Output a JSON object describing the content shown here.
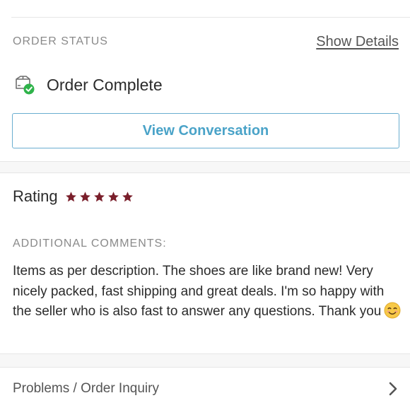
{
  "order_status": {
    "section_label": "ORDER STATUS",
    "show_details_label": "Show Details",
    "status_icon": "package-check-icon",
    "status_text": "Order Complete",
    "view_conversation_label": "View Conversation"
  },
  "rating": {
    "label": "Rating",
    "stars": 5,
    "max_stars": 5,
    "star_color": "#7a1f2b"
  },
  "comments": {
    "label": "ADDITIONAL COMMENTS:",
    "text": "Items as per description. The shoes are like brand new! Very nicely packed, fast shipping and great deals. I'm so happy with the seller who is also fast to answer any questions. Thank you",
    "emoji": "smiling-face-icon"
  },
  "inquiry": {
    "label": "Problems / Order Inquiry",
    "icon": "chevron-right-icon"
  },
  "colors": {
    "accent": "#4aa3c8",
    "success": "#2fb34a",
    "muted": "#8a8a8a"
  }
}
